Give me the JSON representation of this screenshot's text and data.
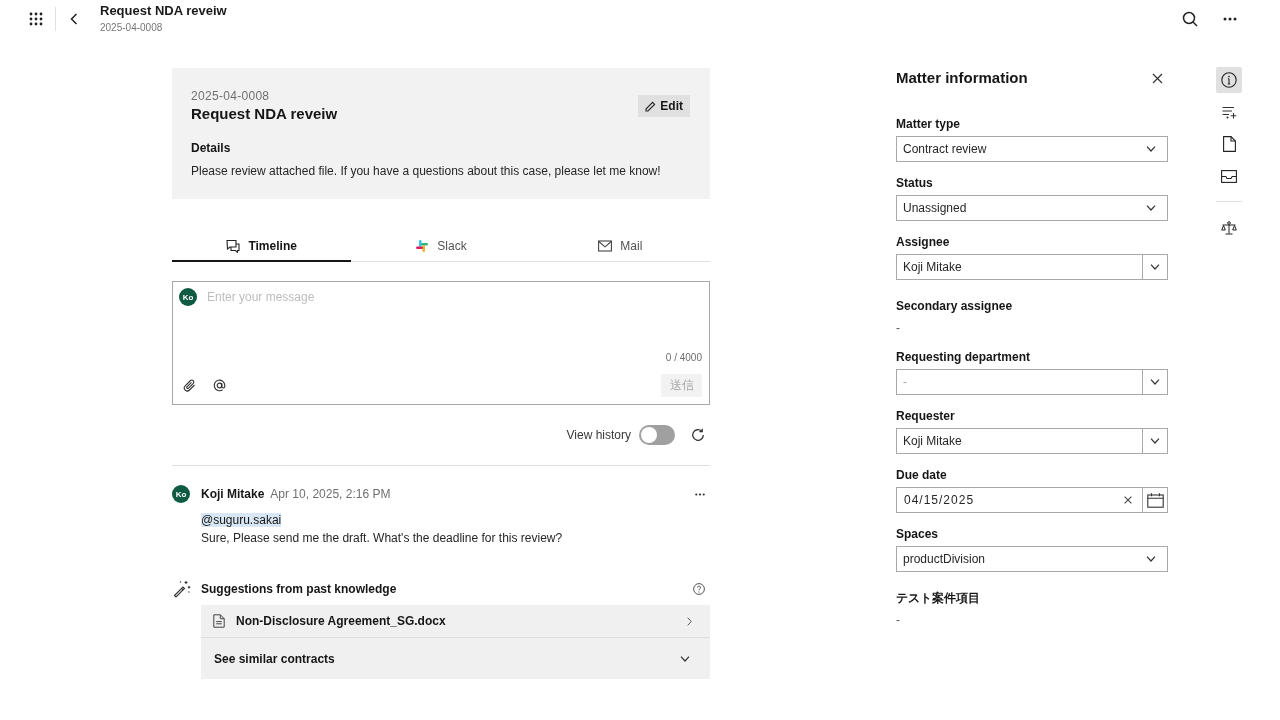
{
  "top_bar": {
    "title": "Request NDA reveiw",
    "subtitle": "2025-04-0008"
  },
  "matter": {
    "number": "2025-04-0008",
    "title": "Request NDA reveiw",
    "edit_button": "Edit",
    "details_heading": "Details",
    "details_text": "Please review attached file. If you have a questions about this case, please let me know!"
  },
  "tabs": [
    {
      "label": "Timeline",
      "selected": true
    },
    {
      "label": "Slack",
      "selected": false
    },
    {
      "label": "Mail",
      "selected": false
    }
  ],
  "composer": {
    "avatar": "Ko",
    "placeholder": "Enter your message",
    "counter": "0 / 4000",
    "send_button": {
      "label": "送信",
      "disabled": true
    }
  },
  "history": {
    "label": "View history",
    "on": false
  },
  "comments": [
    {
      "avatar": "Ko",
      "author": "Koji Mitake",
      "time": "Apr 10, 2025, 2:16 PM",
      "mention": "@suguru.sakai",
      "text": "Sure, Please send me the draft. What's the deadline for this review?"
    }
  ],
  "suggestions": {
    "heading": "Suggestions from past knowledge",
    "items": [
      {
        "kind": "file",
        "label": "Non-Disclosure Agreement_SG.docx"
      },
      {
        "kind": "expander",
        "label": "See similar contracts",
        "expanded": false
      }
    ]
  },
  "panel": {
    "title": "Matter information",
    "fields": [
      {
        "kind": "select",
        "label": "Matter type",
        "value": "Contract review"
      },
      {
        "kind": "select",
        "label": "Status",
        "value": "Unassigned"
      },
      {
        "kind": "combo",
        "label": "Assignee",
        "value": "Koji Mitake"
      },
      {
        "kind": "text",
        "label": "Secondary assignee",
        "value": "-"
      },
      {
        "kind": "combo",
        "label": "Requesting department",
        "placeholder": "-"
      },
      {
        "kind": "combo",
        "label": "Requester",
        "value": "Koji Mitake"
      },
      {
        "kind": "date",
        "label": "Due date",
        "value": "04/15/2025"
      },
      {
        "kind": "select",
        "label": "Spaces",
        "value": "productDivision"
      },
      {
        "kind": "text",
        "label": "テスト案件項目",
        "value": "-"
      }
    ]
  },
  "rail_groups": [
    [
      {
        "selected": true
      },
      {
        "selected": false
      },
      {
        "selected": false
      },
      {
        "selected": false
      }
    ],
    [
      {
        "selected": false
      }
    ]
  ]
}
